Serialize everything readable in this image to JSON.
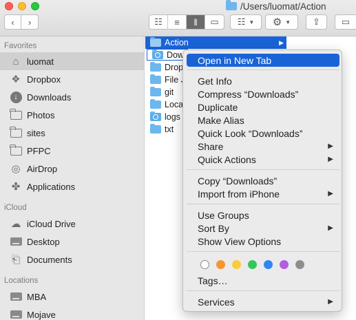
{
  "window": {
    "path": "/Users/luomat/Action"
  },
  "toolbar": {
    "back_icon": "chevron-left",
    "forward_icon": "chevron-right",
    "view_icons": [
      "icon-view",
      "list-view",
      "column-view",
      "gallery-view"
    ],
    "group_icon": "group-by",
    "action_icon": "gear",
    "share_icon": "share",
    "tag_icon": "tag"
  },
  "sidebar": {
    "favorites_label": "Favorites",
    "favorites": [
      "luomat",
      "Dropbox",
      "Downloads",
      "Photos",
      "sites",
      "PFPC",
      "AirDrop",
      "Applications"
    ],
    "icloud_label": "iCloud",
    "icloud": [
      "iCloud Drive",
      "Desktop",
      "Documents"
    ],
    "locations_label": "Locations",
    "locations": [
      "MBA",
      "Mojave"
    ]
  },
  "files": {
    "parent": "Action",
    "items": [
      "Dow",
      "Drop",
      "File J",
      "git",
      "Loca",
      "logs",
      "txt"
    ]
  },
  "menu": {
    "open_new_tab": "Open in New Tab",
    "get_info": "Get Info",
    "compress": "Compress “Downloads”",
    "duplicate": "Duplicate",
    "make_alias": "Make Alias",
    "quick_look": "Quick Look “Downloads”",
    "share": "Share",
    "quick_actions": "Quick Actions",
    "copy": "Copy “Downloads”",
    "import_iphone": "Import from iPhone",
    "use_groups": "Use Groups",
    "sort_by": "Sort By",
    "show_view_options": "Show View Options",
    "tags_label": "Tags…",
    "services": "Services",
    "tag_colors": [
      "#ffffff",
      "#f7952e",
      "#f9cd3a",
      "#33c759",
      "#2f86f5",
      "#b35ee0",
      "#8e8e8e"
    ]
  }
}
